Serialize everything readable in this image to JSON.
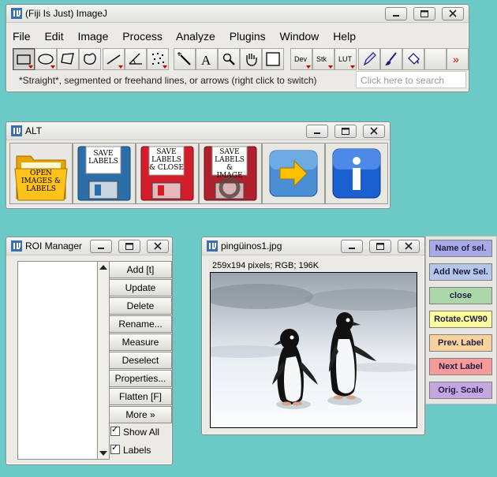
{
  "imagej": {
    "title": "(Fiji Is Just) ImageJ",
    "menus": [
      "File",
      "Edit",
      "Image",
      "Process",
      "Analyze",
      "Plugins",
      "Window",
      "Help"
    ],
    "tools": [
      {
        "name": "rectangle-icon"
      },
      {
        "name": "oval-icon"
      },
      {
        "name": "polygon-icon"
      },
      {
        "name": "freehand-icon"
      },
      {
        "name": "line-icon"
      },
      {
        "name": "angle-icon"
      },
      {
        "name": "multipoint-icon"
      },
      {
        "name": "wand-icon"
      },
      {
        "name": "text-icon"
      },
      {
        "name": "magnifier-icon"
      },
      {
        "name": "hand-icon"
      },
      {
        "name": "color-picker-icon"
      },
      {
        "name": "dev-menu",
        "label": "Dev"
      },
      {
        "name": "stk-menu",
        "label": "Stk"
      },
      {
        "name": "lut-menu",
        "label": "LUT"
      },
      {
        "name": "pencil-icon"
      },
      {
        "name": "brush-icon"
      },
      {
        "name": "flood-fill-icon"
      },
      {
        "name": "more-tools-icon",
        "label": "»"
      }
    ],
    "status": "*Straight*, segmented or freehand lines, or arrows (right click to switch)",
    "search_placeholder": "Click here to search",
    "accent_color": "#cc0000"
  },
  "alt": {
    "title": "ALT",
    "buttons": [
      {
        "label_lines": [
          "OPEN",
          "IMAGES &",
          "LABELS"
        ]
      },
      {
        "label_lines": [
          "SAVE",
          "LABELS"
        ]
      },
      {
        "label_lines": [
          "SAVE",
          "LABELS",
          "& CLOSE"
        ]
      },
      {
        "label_lines": [
          "SAVE",
          "LABELS &",
          "IMAGE"
        ]
      },
      {
        "label_lines": []
      },
      {
        "label_lines": []
      }
    ]
  },
  "roi_manager": {
    "title": "ROI Manager",
    "buttons": [
      "Add [t]",
      "Update",
      "Delete",
      "Rename...",
      "Measure",
      "Deselect",
      "Properties...",
      "Flatten [F]",
      "More »"
    ],
    "checkboxes": [
      {
        "label": "Show All",
        "checked": true
      },
      {
        "label": "Labels",
        "checked": true
      }
    ]
  },
  "image_window": {
    "title": "pingüinos1.jpg",
    "info": "259x194 pixels; RGB; 196K"
  },
  "side_panel": {
    "buttons": [
      {
        "label": "Name of sel.",
        "color": "#a9a9e8"
      },
      {
        "label": "Add New Sel.",
        "color": "#b6c6ea"
      },
      {
        "label": "close",
        "color": "#abd8a8"
      },
      {
        "label": "Rotate.CW90",
        "color": "#fbfb9a"
      },
      {
        "label": "Prev. Label",
        "color": "#f8d29c"
      },
      {
        "label": "Next Label",
        "color": "#f69a9a"
      },
      {
        "label": "Orig. Scale",
        "color": "#c5a6e0"
      }
    ]
  }
}
